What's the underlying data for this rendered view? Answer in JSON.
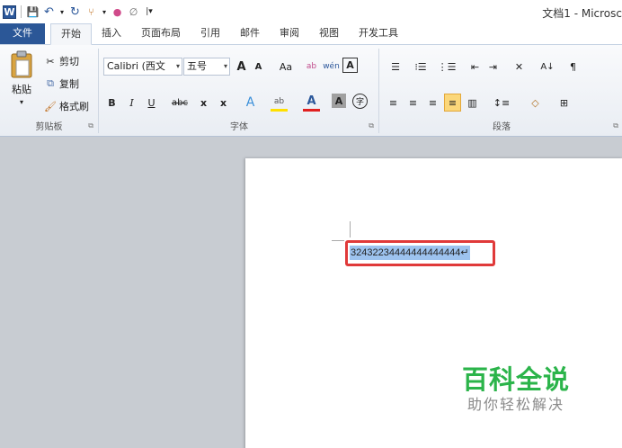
{
  "qat": {
    "word": "W",
    "save": "💾",
    "undo": "↶",
    "undo_drop": "▾",
    "redo": "↻",
    "format": "⑂",
    "format_drop": "▾",
    "color": "●",
    "sign": "∅",
    "more": "|▾"
  },
  "title": "文档1 - Microsc",
  "tabs": [
    "文件",
    "开始",
    "插入",
    "页面布局",
    "引用",
    "邮件",
    "审阅",
    "视图",
    "开发工具"
  ],
  "clipboard": {
    "paste_label": "粘贴",
    "paste_arrow": "▾",
    "cut_label": "剪切",
    "copy_label": "复制",
    "format_painter_label": "格式刷",
    "group_label": "剪贴板",
    "launcher": "⧉"
  },
  "font": {
    "font_name": "Calibri (西文",
    "font_size": "五号",
    "combo_arrow": "▾",
    "grow": "A",
    "shrink": "A",
    "change_case": "Aa",
    "clear_format": "ab",
    "phonetic": "wén",
    "border_char": "A",
    "bold": "B",
    "italic": "I",
    "underline": "U",
    "strike": "abc",
    "subscript": "x",
    "superscript": "x",
    "text_effect": "A",
    "highlight": "ab",
    "font_color": "A",
    "char_shading": "A",
    "enclose": "字",
    "group_label": "字体",
    "launcher": "⧉"
  },
  "paragraph": {
    "bullets": "☰",
    "numbering": "⁝☰",
    "multilevel": "⋮☰",
    "decrease_indent": "⇤",
    "increase_indent": "⇥",
    "chinese_layout": "✕",
    "sort": "A↓",
    "show_marks": "¶",
    "align_left": "≡",
    "center": "≡",
    "align_right": "≡",
    "justify": "≡",
    "distributed": "▥",
    "line_spacing": "↕≡",
    "shading": "◇",
    "borders": "⊞",
    "group_label": "段落",
    "launcher": "⧉"
  },
  "document": {
    "selected_text": "32432234444444444444↵"
  },
  "watermark": {
    "main": "百科全说",
    "sub": "助你轻松解决"
  },
  "colors": {
    "file_tab": "#2b5797",
    "selection": "#9dc3ef",
    "callout_border": "#e03a3a",
    "watermark_green": "#2bb44a"
  }
}
